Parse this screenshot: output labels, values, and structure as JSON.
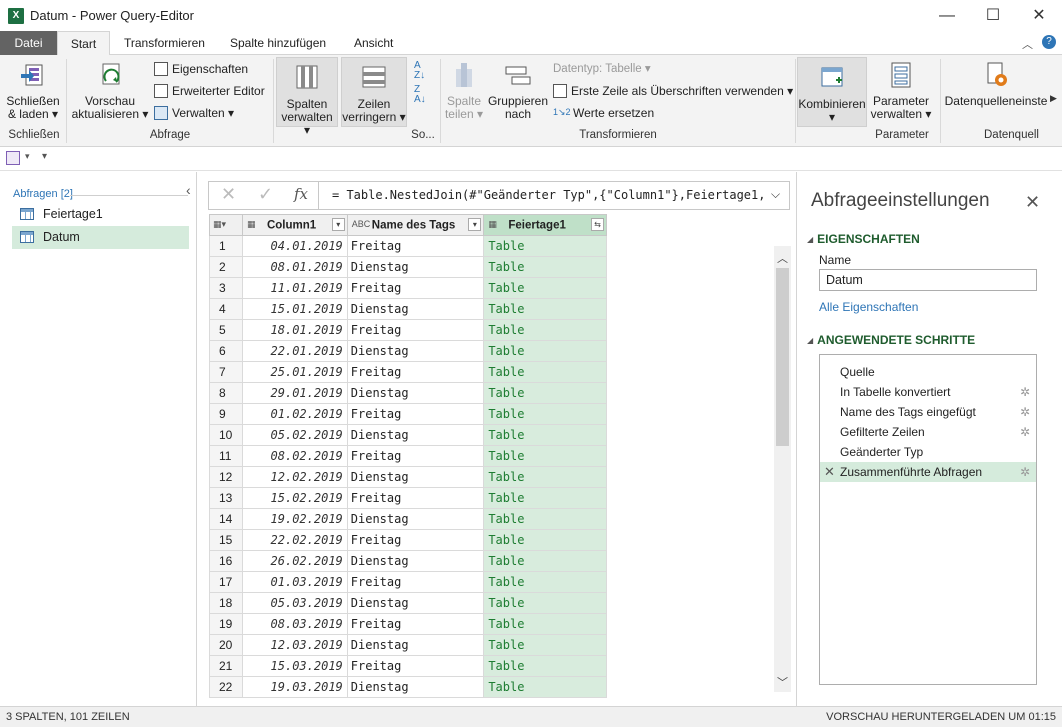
{
  "window": {
    "title": "Datum - Power Query-Editor",
    "app_icon": "X",
    "minimize_icon": "—",
    "maximize_icon": "☐",
    "close_icon": "✕"
  },
  "tabs": [
    "Datei",
    "Start",
    "Transformieren",
    "Spalte hinzufügen",
    "Ansicht"
  ],
  "ribbon": {
    "close_load": "Schließen & laden",
    "close_load_l1": "Schließen",
    "close_load_l2": "& laden",
    "group_close": "Schließen",
    "refresh_l1": "Vorschau",
    "refresh_l2": "aktualisieren",
    "properties": "Eigenschaften",
    "advanced_editor": "Erweiterter Editor",
    "manage": "Verwalten",
    "group_query": "Abfrage",
    "manage_cols_l1": "Spalten",
    "manage_cols_l2": "verwalten",
    "reduce_rows_l1": "Zeilen",
    "reduce_rows_l2": "verringern",
    "group_sort": "So...",
    "split_col_l1": "Spalte",
    "split_col_l2": "teilen",
    "group_by_l1": "Gruppieren",
    "group_by_l2": "nach",
    "datatype": "Datentyp: Tabelle",
    "first_row_headers": "Erste Zeile als Überschriften verwenden",
    "replace_values": "Werte ersetzen",
    "group_transform": "Transformieren",
    "combine": "Kombinieren",
    "params_l1": "Parameter",
    "params_l2": "verwalten",
    "group_params": "Parameter",
    "datasource": "Datenquelleneinste",
    "group_datasource": "Datenquell"
  },
  "queries": {
    "header": "Abfragen [2]",
    "items": [
      {
        "label": "Feiertage1",
        "selected": false
      },
      {
        "label": "Datum",
        "selected": true
      }
    ]
  },
  "formula": "= Table.NestedJoin(#\"Geänderter Typ\",{\"Column1\"},Feiertage1,",
  "grid": {
    "headers": [
      "Column1",
      "Name des Tags",
      "Feiertage1"
    ],
    "rows": [
      [
        "1",
        "04.01.2019",
        "Freitag",
        "Table"
      ],
      [
        "2",
        "08.01.2019",
        "Dienstag",
        "Table"
      ],
      [
        "3",
        "11.01.2019",
        "Freitag",
        "Table"
      ],
      [
        "4",
        "15.01.2019",
        "Dienstag",
        "Table"
      ],
      [
        "5",
        "18.01.2019",
        "Freitag",
        "Table"
      ],
      [
        "6",
        "22.01.2019",
        "Dienstag",
        "Table"
      ],
      [
        "7",
        "25.01.2019",
        "Freitag",
        "Table"
      ],
      [
        "8",
        "29.01.2019",
        "Dienstag",
        "Table"
      ],
      [
        "9",
        "01.02.2019",
        "Freitag",
        "Table"
      ],
      [
        "10",
        "05.02.2019",
        "Dienstag",
        "Table"
      ],
      [
        "11",
        "08.02.2019",
        "Freitag",
        "Table"
      ],
      [
        "12",
        "12.02.2019",
        "Dienstag",
        "Table"
      ],
      [
        "13",
        "15.02.2019",
        "Freitag",
        "Table"
      ],
      [
        "14",
        "19.02.2019",
        "Dienstag",
        "Table"
      ],
      [
        "15",
        "22.02.2019",
        "Freitag",
        "Table"
      ],
      [
        "16",
        "26.02.2019",
        "Dienstag",
        "Table"
      ],
      [
        "17",
        "01.03.2019",
        "Freitag",
        "Table"
      ],
      [
        "18",
        "05.03.2019",
        "Dienstag",
        "Table"
      ],
      [
        "19",
        "08.03.2019",
        "Freitag",
        "Table"
      ],
      [
        "20",
        "12.03.2019",
        "Dienstag",
        "Table"
      ],
      [
        "21",
        "15.03.2019",
        "Freitag",
        "Table"
      ],
      [
        "22",
        "19.03.2019",
        "Dienstag",
        "Table"
      ]
    ]
  },
  "settings": {
    "title": "Abfrageeinstellungen",
    "properties_header": "EIGENSCHAFTEN",
    "name_label": "Name",
    "name_value": "Datum",
    "all_properties": "Alle Eigenschaften",
    "steps_header": "ANGEWENDETE SCHRITTE",
    "steps": [
      {
        "label": "Quelle",
        "gear": false,
        "selected": false
      },
      {
        "label": "In Tabelle konvertiert",
        "gear": true,
        "selected": false
      },
      {
        "label": "Name des Tags eingefügt",
        "gear": true,
        "selected": false
      },
      {
        "label": "Gefilterte Zeilen",
        "gear": true,
        "selected": false
      },
      {
        "label": "Geänderter Typ",
        "gear": false,
        "selected": false
      },
      {
        "label": "Zusammenführte Abfragen",
        "gear": true,
        "selected": true
      }
    ]
  },
  "status": {
    "left": "3 SPALTEN, 101 ZEILEN",
    "right": "VORSCHAU HERUNTERGELADEN UM 01:15"
  },
  "colors": {
    "accent_green": "#1e7d32",
    "selection_green": "#d5ebdc",
    "link_blue": "#2e75b6",
    "file_tab": "#636363"
  }
}
